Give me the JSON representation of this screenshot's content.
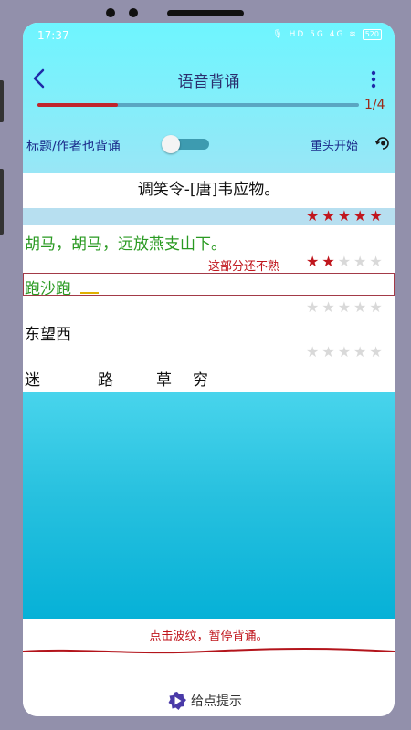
{
  "status": {
    "time": "17:37",
    "icons": "🎙 HD 5G 4G ≋",
    "battery": "520"
  },
  "header": {
    "title": "语音背诵",
    "progress_text": "1/4",
    "progress_fraction": 0.25
  },
  "options": {
    "toggle_label": "标题/作者也背诵",
    "toggle_on": false,
    "restart_label": "重头开始"
  },
  "poem": {
    "title": "调笑令-[唐]韦应物。",
    "title_stars": 5,
    "line1": {
      "text": "胡马，胡马，远放燕支山下。",
      "stars": 2,
      "hint": "这部分还不熟"
    },
    "input": {
      "value": "跑沙跑",
      "stars": 0
    },
    "line3": {
      "text": "东望西",
      "stars": 0
    },
    "line4": {
      "chars": [
        "迷",
        "路",
        "草",
        "穷"
      ]
    }
  },
  "footer": {
    "pause_hint": "点击波纹，暂停背诵。",
    "hint_button": "给点提示"
  },
  "colors": {
    "accent_red": "#c0161d",
    "green_text": "#2a9a22",
    "navy": "#1a2a8a",
    "cyan": "#06b1d7"
  },
  "icons": {
    "back": "chevron-left-icon",
    "more": "more-vertical-icon",
    "restart": "eye-refresh-icon",
    "hint": "play-hint-icon"
  }
}
